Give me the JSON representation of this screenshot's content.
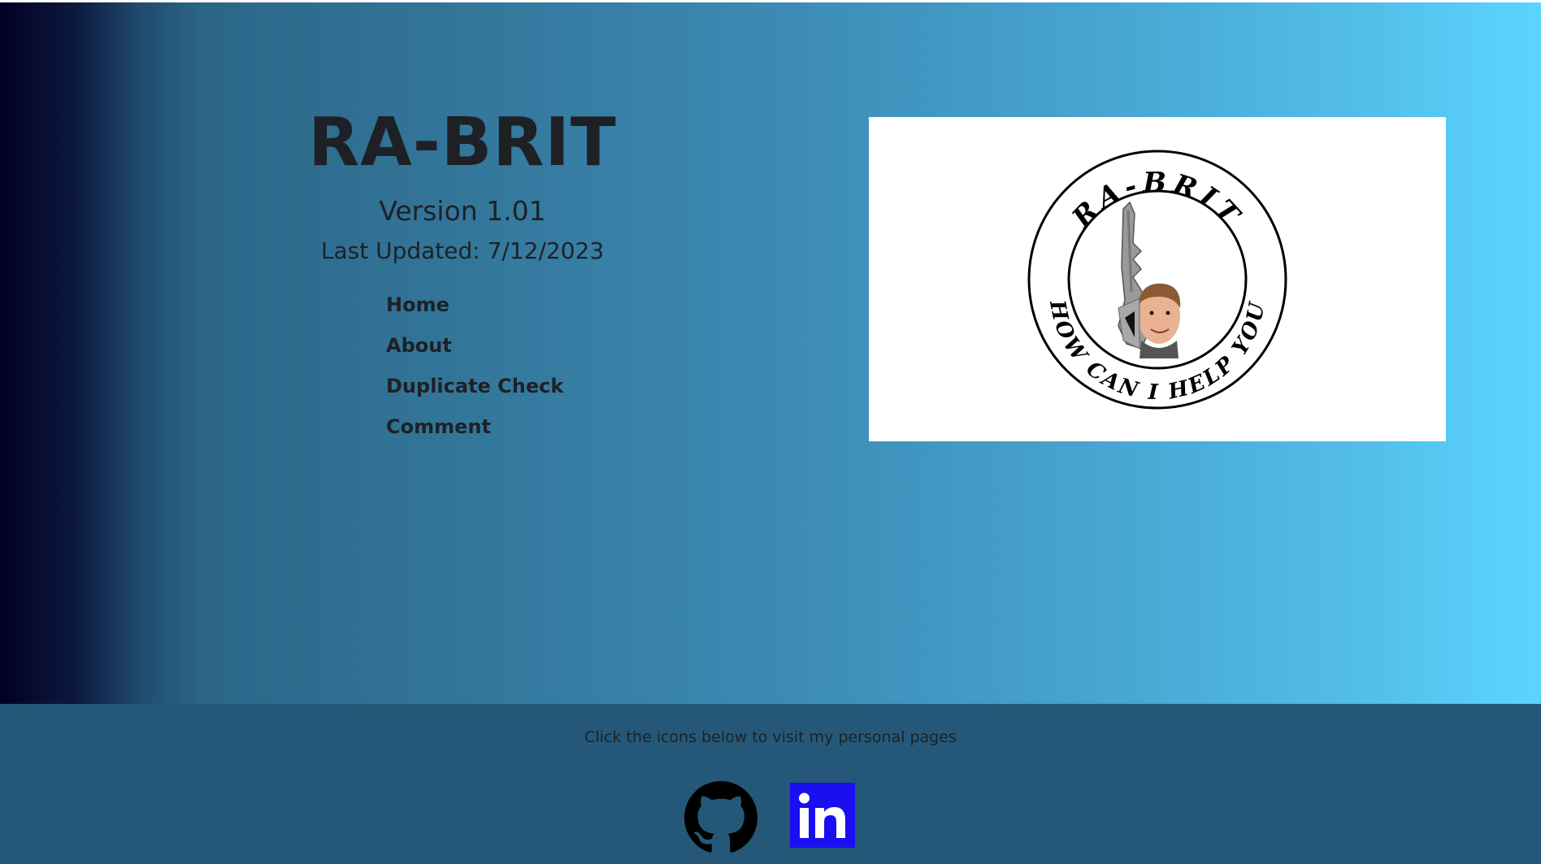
{
  "header": {
    "title": "RA-BRIT",
    "version": "Version 1.01",
    "last_updated": "Last Updated: 7/12/2023"
  },
  "nav": {
    "items": [
      {
        "label": "Home"
      },
      {
        "label": "About"
      },
      {
        "label": "Duplicate Check"
      },
      {
        "label": "Comment"
      }
    ]
  },
  "logo": {
    "top_text": "RA-BRIT",
    "bottom_text": "HOW CAN I HELP YOU",
    "icon": "key-with-face-logo"
  },
  "footer": {
    "text": "Click the icons below to visit my personal pages",
    "links": [
      {
        "icon": "github-icon"
      },
      {
        "icon": "linkedin-icon",
        "color": "#1b0ef0"
      }
    ]
  },
  "colors": {
    "gradient_start": "#020024",
    "gradient_end": "#5ad5ff",
    "footer_bg": "#255878",
    "text": "#1d2125"
  }
}
